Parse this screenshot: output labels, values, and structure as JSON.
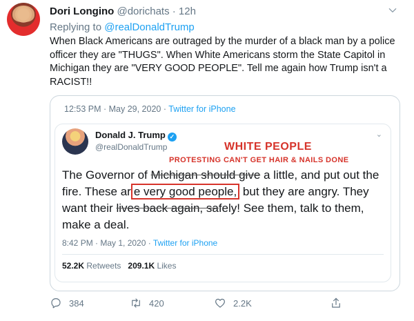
{
  "tweet": {
    "author_name": "Dori Longino",
    "author_handle": "@dorichats",
    "separator": "·",
    "time_ago": "12h",
    "replying_prefix": "Replying to",
    "replying_to": "@realDonaldTrump",
    "text": "When Black Americans  are outraged by the murder of a black man by a police officer they are \"THUGS\". When White Americans storm the State Capitol in Michigan they are \"VERY GOOD PEOPLE\". Tell me again how Trump isn't a RACIST!!"
  },
  "quoted": {
    "timestamp": "12:53 PM · May 29, 2020 ·",
    "source": "Twitter for iPhone"
  },
  "embedded": {
    "author_name": "Donald J. Trump",
    "author_handle": "@realDonaldTrump",
    "annotation_title": "WHITE PEOPLE",
    "annotation_sub": "PROTESTING CAN'T GET HAIR & NAILS DONE",
    "text_1": "The Governor of ",
    "text_2": "Michigan should give",
    "text_3": " a little, and put out the fire. These ar",
    "text_4": "e ",
    "highlight": "very good people,",
    "text_5": " but they are angry. They want their ",
    "text_6": "lives back again, sa",
    "text_7": "fely! See them, talk to them, make a deal.",
    "timestamp": "8:42 PM · May 1, 2020 ·",
    "source": "Twitter for iPhone",
    "retweets": "52.2K",
    "retweets_label": "Retweets",
    "likes": "209.1K",
    "likes_label": "Likes"
  },
  "actions": {
    "reply_count": "384",
    "retweet_count": "420",
    "like_count": "2.2K"
  },
  "colors": {
    "accent": "#1da1f2",
    "annotation": "#d6332a"
  }
}
